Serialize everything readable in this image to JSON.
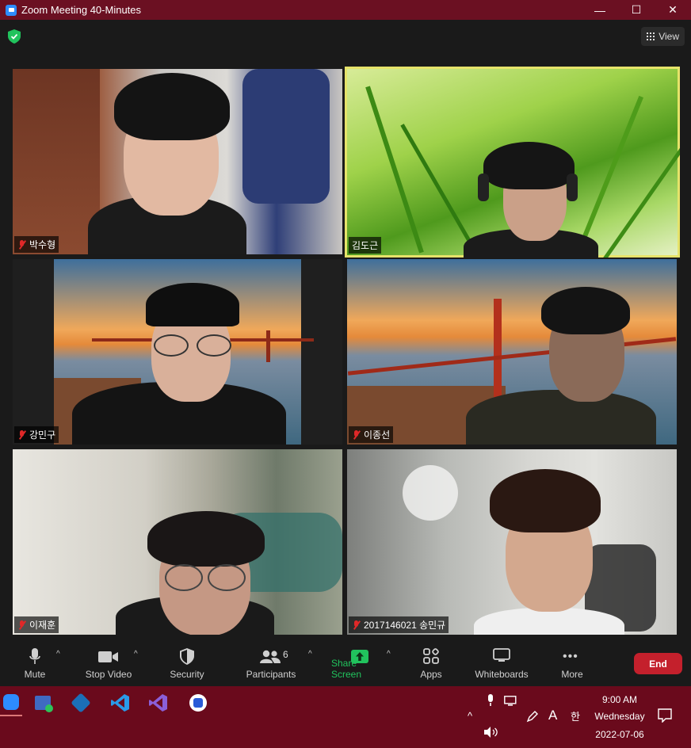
{
  "window": {
    "title": "Zoom Meeting 40-Minutes",
    "minimize": "—",
    "maximize": "☐",
    "close": "✕"
  },
  "view_button": {
    "label": "View"
  },
  "participants_tiles": [
    {
      "name": "박수형",
      "muted": true,
      "active_speaker": false
    },
    {
      "name": "김도근",
      "muted": false,
      "active_speaker": true
    },
    {
      "name": "강민구",
      "muted": true,
      "active_speaker": false
    },
    {
      "name": "이종선",
      "muted": true,
      "active_speaker": false
    },
    {
      "name": "이재훈",
      "muted": true,
      "active_speaker": false
    },
    {
      "name": "2017146021 송민규",
      "muted": true,
      "active_speaker": false
    }
  ],
  "toolbar": {
    "mute": "Mute",
    "stop_video": "Stop Video",
    "security": "Security",
    "participants": "Participants",
    "participants_count": "6",
    "share_screen": "Share Screen",
    "apps": "Apps",
    "whiteboards": "Whiteboards",
    "more": "More",
    "end": "End",
    "caret": "^"
  },
  "taskbar": {
    "time": "9:00 AM",
    "day": "Wednesday",
    "date": "2022-07-06",
    "ime_a": "A",
    "ime_han": "한",
    "chevron": "^"
  },
  "colors": {
    "title_bar": "#6b1022",
    "taskbar": "#6a0a1c",
    "share_green": "#21c35d",
    "end_red": "#c4202c",
    "active_border": "#e6e36a"
  }
}
